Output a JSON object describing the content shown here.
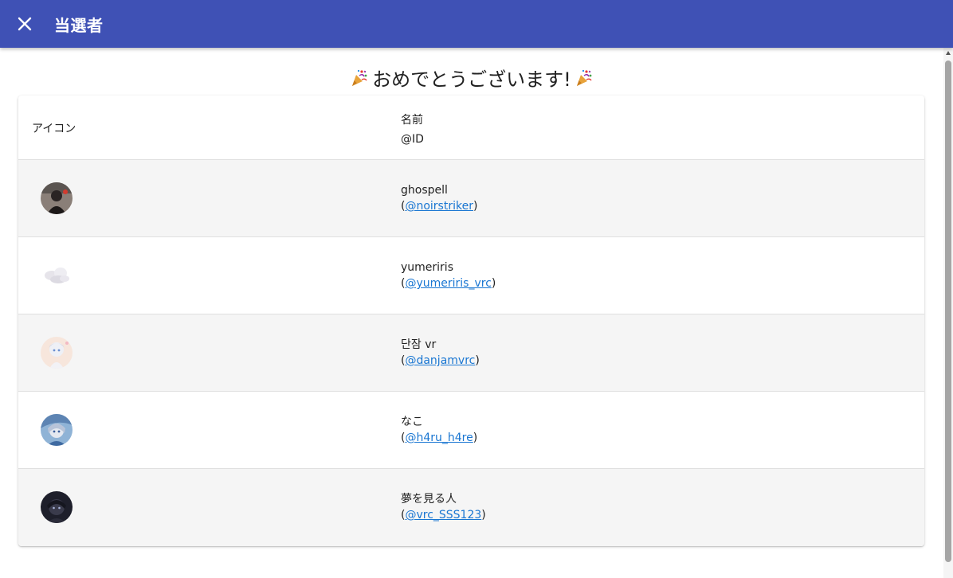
{
  "appbar": {
    "title": "当選者",
    "close_icon": "close-icon"
  },
  "heading": {
    "text": "おめでとうございます!",
    "left_icon": "party-popper-icon",
    "right_icon": "party-popper-icon"
  },
  "table": {
    "header": {
      "icon": "アイコン",
      "name": "名前",
      "id": "@ID"
    },
    "rows": [
      {
        "name": "ghospell",
        "handle": "@noirstriker"
      },
      {
        "name": "yumeriris",
        "handle": "@yumeriris_vrc"
      },
      {
        "name": "단잠 vr",
        "handle": "@danjamvrc"
      },
      {
        "name": "なこ",
        "handle": "@h4ru_h4re"
      },
      {
        "name": "夢を見る人",
        "handle": "@vrc_SSS123"
      }
    ]
  },
  "colors": {
    "appbar": "#3f51b5",
    "link": "#1976d2",
    "row_shade": "#f5f5f5"
  }
}
